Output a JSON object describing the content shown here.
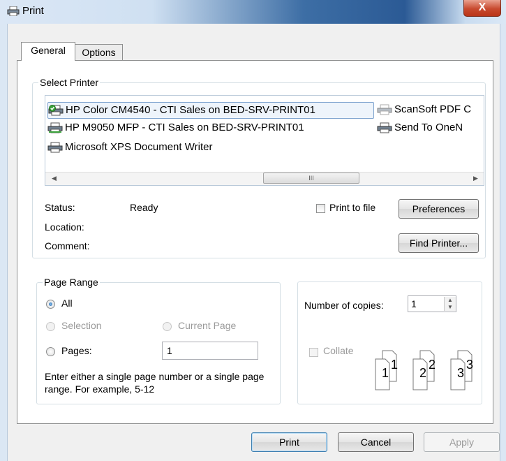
{
  "window": {
    "title": "Print",
    "close_label": "X"
  },
  "tabs": [
    {
      "label": "General"
    },
    {
      "label": "Options"
    }
  ],
  "select_printer": {
    "legend": "Select Printer",
    "printers": [
      {
        "name": "HP Color CM4540 - CTI Sales on BED-SRV-PRINT01",
        "selected": true,
        "default": true
      },
      {
        "name": "ScanSoft PDF C",
        "selected": false
      },
      {
        "name": "HP M9050 MFP - CTI Sales on BED-SRV-PRINT01",
        "selected": false
      },
      {
        "name": "Send To OneN",
        "selected": false
      },
      {
        "name": "Microsoft XPS Document Writer",
        "selected": false
      }
    ],
    "scroll_thumb_label": "III",
    "status_label": "Status:",
    "status_value": "Ready",
    "location_label": "Location:",
    "comment_label": "Comment:",
    "print_to_file_label": "Print to file",
    "preferences_label": "Preferences",
    "find_printer_label": "Find Printer..."
  },
  "page_range": {
    "legend": "Page Range",
    "all_label": "All",
    "selection_label": "Selection",
    "current_page_label": "Current Page",
    "pages_label": "Pages:",
    "pages_value": "1",
    "hint": "Enter either a single page number or a single page range.  For example, 5-12"
  },
  "copies": {
    "label": "Number of copies:",
    "value": "1",
    "collate_label": "Collate",
    "collate_numbers": [
      "1",
      "1",
      "2",
      "2",
      "3",
      "3"
    ]
  },
  "footer": {
    "print_label": "Print",
    "cancel_label": "Cancel",
    "apply_label": "Apply"
  },
  "colors": {
    "accent": "#3c7fb1",
    "close": "#c84a2f",
    "disabled_text": "#9a9a9a"
  }
}
